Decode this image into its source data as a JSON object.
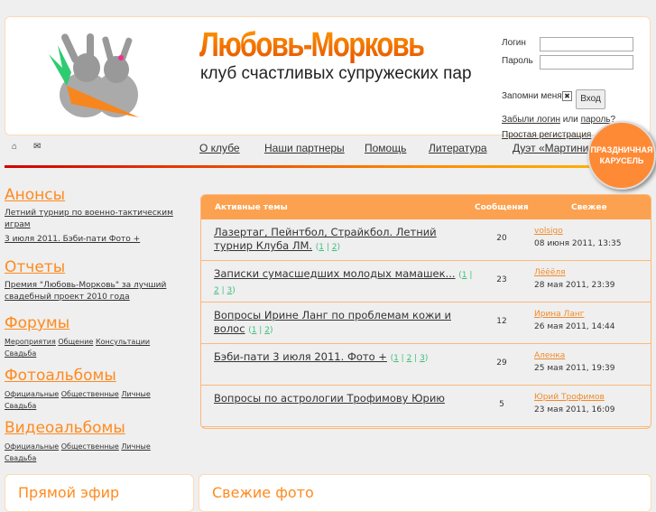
{
  "header": {
    "title": "Любовь-Морковь",
    "subtitle": "клуб счастливых супружеских пар"
  },
  "login": {
    "login_label": "Логин",
    "password_label": "Пароль",
    "remember_label": "Запомни меня",
    "remember_checked": true,
    "submit": "Вход",
    "forgot_login": "Забыли логин",
    "or": "или",
    "forgot_password": "пароль?",
    "register": "Простая регистрация"
  },
  "nav": {
    "home_icon": "home-icon",
    "mail_icon": "mail-icon",
    "items": [
      "О клубе",
      "Наши партнеры",
      "Помощь",
      "Литература",
      "Дуэт «Мартини»"
    ]
  },
  "badge": {
    "line1": "ПРАЗДНИЧНАЯ",
    "line2": "КАРУСЕЛЬ"
  },
  "sidebar": {
    "announces": {
      "title": "Анонсы",
      "items": [
        "Летний турнир по военно-тактическим играм",
        "3 июля 2011. Бэби-пати Фото +"
      ]
    },
    "reports": {
      "title": "Отчеты",
      "items": [
        "Премия \"Любовь-Морковь\" за лучший свадебный проект 2010 года"
      ]
    },
    "forums": {
      "title": "Форумы",
      "items": [
        "Мероприятия",
        "Общение",
        "Консультации",
        "Свадьба"
      ]
    },
    "photos": {
      "title": "Фотоальбомы",
      "items": [
        "Официальные",
        "Общественные",
        "Личные",
        "Свадьба"
      ]
    },
    "videos": {
      "title": "Видеоальбомы",
      "items": [
        "Официальные",
        "Общественные",
        "Личные",
        "Свадьба"
      ]
    }
  },
  "topics": {
    "headers": [
      "Активные темы",
      "Сообщения",
      "Свежее"
    ],
    "rows": [
      {
        "title": "Лазертаг, Пейнтбол, Страйкбол. Летний турнир Клуба ЛМ.",
        "pages": [
          "1",
          "2"
        ],
        "count": "20",
        "user": "volsigo",
        "date": "08 июня 2011, 13:35"
      },
      {
        "title": "Записки сумасшедших молодых мамашек...",
        "pages": [
          "1",
          "2",
          "3"
        ],
        "count": "23",
        "user": "Лёёёля",
        "date": "28 мая 2011, 23:39"
      },
      {
        "title": "Вопросы Ирине Ланг по проблемам кожи и волос",
        "pages": [
          "1",
          "2"
        ],
        "count": "12",
        "user": "Ирина Ланг",
        "date": "26 мая 2011, 14:44"
      },
      {
        "title": "Бэби-пати 3 июля 2011. Фото +",
        "pages": [
          "1",
          "2",
          "3"
        ],
        "count": "29",
        "user": "Аленка",
        "date": "25 мая 2011, 19:39"
      },
      {
        "title": "Вопросы по астрологии Трофимову Юрию",
        "pages": [],
        "count": "5",
        "user": "Юрий Трофимов",
        "date": "23 мая 2011, 16:09"
      }
    ]
  },
  "bottom": {
    "live": "Прямой эфир",
    "fresh_photos": "Свежие фото"
  }
}
